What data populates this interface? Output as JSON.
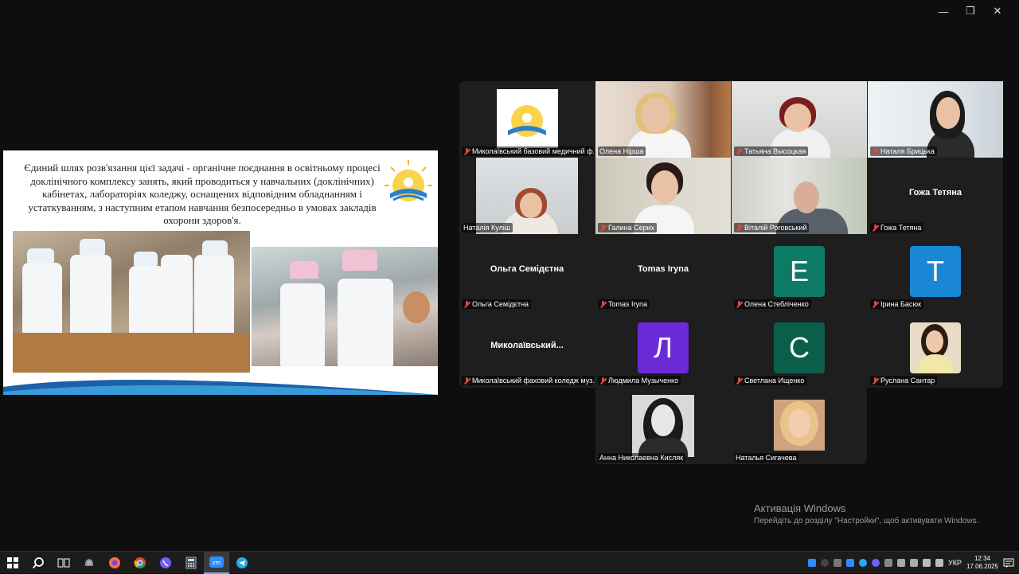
{
  "window_controls": {
    "minimize": "—",
    "restore": "❐",
    "close": "✕"
  },
  "slide": {
    "text": "Єдиний шлях розв'язання цієї задачі - органічне поєднання в освітньому процесі доклінічного комплексу занять, який проводиться у навчальних (доклінічних) кабінетах, лабораторіях коледжу, оснащених відповідним обладнанням і устаткуванням, з наступним етапом навчання безпосередньо в умовах закладів охорони здоров'я."
  },
  "participants": [
    {
      "name": "Миколаївський базовий медичний ф...",
      "type": "logo"
    },
    {
      "name": "Олена Нірша",
      "type": "video",
      "active": true
    },
    {
      "name": "Татьяна Высоцкая",
      "type": "video"
    },
    {
      "name": "Наталя Брицька",
      "type": "video"
    },
    {
      "name": "Наталія Куліш",
      "type": "video"
    },
    {
      "name": "Галина Серих",
      "type": "video"
    },
    {
      "name": "Віталій Роговський",
      "type": "video"
    },
    {
      "name": "Гожа Тетяна",
      "type": "text",
      "display": "Гожа Тетяна"
    },
    {
      "name": "Ольга Семідєтна",
      "type": "text",
      "display": "Ольга Семідєтна"
    },
    {
      "name": "Tomas Iryna",
      "type": "text",
      "display": "Tomas Iryna"
    },
    {
      "name": "Олена Стебліченко",
      "type": "letter",
      "letter": "E",
      "color": "#0e7a66"
    },
    {
      "name": "Ірина Басюк",
      "type": "letter",
      "letter": "T",
      "color": "#1a86d6"
    },
    {
      "name": "Миколаївський фаховий коледж муз...",
      "type": "text",
      "display": "Миколаївський..."
    },
    {
      "name": "Людмила Музыченко",
      "type": "letter",
      "letter": "Л",
      "color": "#6a2bd6"
    },
    {
      "name": "Светлана Ищенко",
      "type": "letter",
      "letter": "С",
      "color": "#0b5e4a"
    },
    {
      "name": "Руслана Сантар",
      "type": "photo"
    },
    {
      "name": "Анна Николаевна Кисляк",
      "type": "photo"
    },
    {
      "name": "Наталья Сигачева",
      "type": "photo"
    }
  ],
  "activation": {
    "title": "Активація Windows",
    "subtitle": "Перейдіть до розділу \"Настройки\", щоб активувати Windows."
  },
  "taskbar": {
    "lang": "УКР",
    "time": "12:34",
    "date": "17.06.2025"
  }
}
